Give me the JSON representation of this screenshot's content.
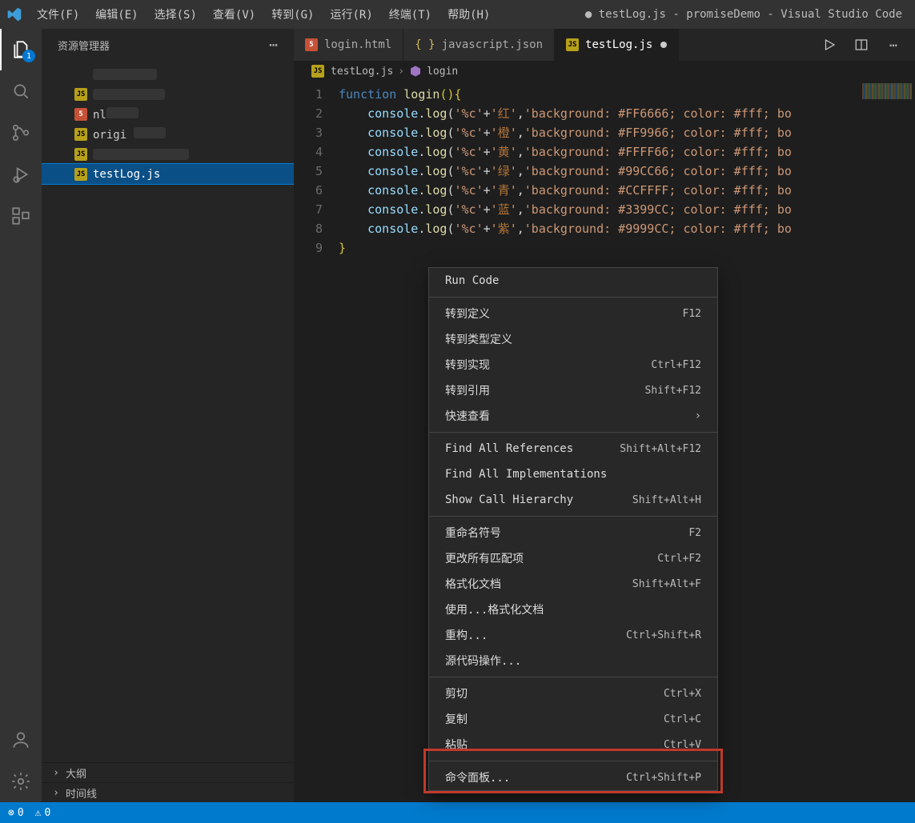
{
  "menubar": {
    "items": [
      "文件(F)",
      "编辑(E)",
      "选择(S)",
      "查看(V)",
      "转到(G)",
      "运行(R)",
      "终端(T)",
      "帮助(H)"
    ],
    "title": "● testLog.js - promiseDemo - Visual Studio Code"
  },
  "activity": {
    "explorerBadge": "1"
  },
  "sidebar": {
    "header": "资源管理器",
    "tree": [
      {
        "icon": "none",
        "label": ""
      },
      {
        "icon": "js",
        "label": ""
      },
      {
        "icon": "html",
        "label": "          nl"
      },
      {
        "icon": "js",
        "label": "origi  "
      },
      {
        "icon": "js",
        "label": ""
      },
      {
        "icon": "js",
        "label": "testLog.js",
        "active": true
      }
    ],
    "outline": "大纲",
    "timeline": "时间线"
  },
  "tabs": [
    {
      "icon": "html",
      "label": "login.html",
      "active": false,
      "dirty": false
    },
    {
      "icon": "json",
      "label": "javascript.json",
      "active": false,
      "dirty": false
    },
    {
      "icon": "js",
      "label": "testLog.js",
      "active": true,
      "dirty": true
    }
  ],
  "crumbs": {
    "file": "testLog.js",
    "sym": "login",
    "symIcon": "cube"
  },
  "code": {
    "lines": [
      1,
      2,
      3,
      4,
      5,
      6,
      7,
      8,
      9
    ],
    "rows": [
      {
        "type": "fn_open"
      },
      {
        "type": "log",
        "char": "红",
        "bg": "#FF6666"
      },
      {
        "type": "log",
        "char": "橙",
        "bg": "#FF9966"
      },
      {
        "type": "log",
        "char": "黄",
        "bg": "#FFFF66"
      },
      {
        "type": "log",
        "char": "绿",
        "bg": "#99CC66"
      },
      {
        "type": "log",
        "char": "青",
        "bg": "#CCFFFF"
      },
      {
        "type": "log",
        "char": "蓝",
        "bg": "#3399CC"
      },
      {
        "type": "log",
        "char": "紫",
        "bg": "#9999CC"
      },
      {
        "type": "fn_close"
      }
    ],
    "fn_keyword": "function",
    "fn_name": "login",
    "console_obj": "console",
    "log_fn": "log",
    "str_pfx": "'%c'",
    "style_suffix": "color: #fff; bo",
    "style_prefix": "background: "
  },
  "context_menu": [
    {
      "type": "item",
      "label": "Run Code",
      "kbd": ""
    },
    {
      "type": "sep"
    },
    {
      "type": "item",
      "label": "转到定义",
      "kbd": "F12"
    },
    {
      "type": "item",
      "label": "转到类型定义",
      "kbd": ""
    },
    {
      "type": "item",
      "label": "转到实现",
      "kbd": "Ctrl+F12"
    },
    {
      "type": "item",
      "label": "转到引用",
      "kbd": "Shift+F12"
    },
    {
      "type": "item",
      "label": "快速查看",
      "kbd": "",
      "more": true
    },
    {
      "type": "sep"
    },
    {
      "type": "item",
      "label": "Find All References",
      "kbd": "Shift+Alt+F12"
    },
    {
      "type": "item",
      "label": "Find All Implementations",
      "kbd": ""
    },
    {
      "type": "item",
      "label": "Show Call Hierarchy",
      "kbd": "Shift+Alt+H"
    },
    {
      "type": "sep"
    },
    {
      "type": "item",
      "label": "重命名符号",
      "kbd": "F2"
    },
    {
      "type": "item",
      "label": "更改所有匹配项",
      "kbd": "Ctrl+F2"
    },
    {
      "type": "item",
      "label": "格式化文档",
      "kbd": "Shift+Alt+F"
    },
    {
      "type": "item",
      "label": "使用...格式化文档",
      "kbd": ""
    },
    {
      "type": "item",
      "label": "重构...",
      "kbd": "Ctrl+Shift+R"
    },
    {
      "type": "item",
      "label": "源代码操作...",
      "kbd": ""
    },
    {
      "type": "sep"
    },
    {
      "type": "item",
      "label": "剪切",
      "kbd": "Ctrl+X"
    },
    {
      "type": "item",
      "label": "复制",
      "kbd": "Ctrl+C"
    },
    {
      "type": "item",
      "label": "粘贴",
      "kbd": "Ctrl+V"
    },
    {
      "type": "sep"
    },
    {
      "type": "item",
      "label": "命令面板...",
      "kbd": "Ctrl+Shift+P"
    }
  ],
  "status": {
    "errors": "0",
    "warnings": "0"
  }
}
